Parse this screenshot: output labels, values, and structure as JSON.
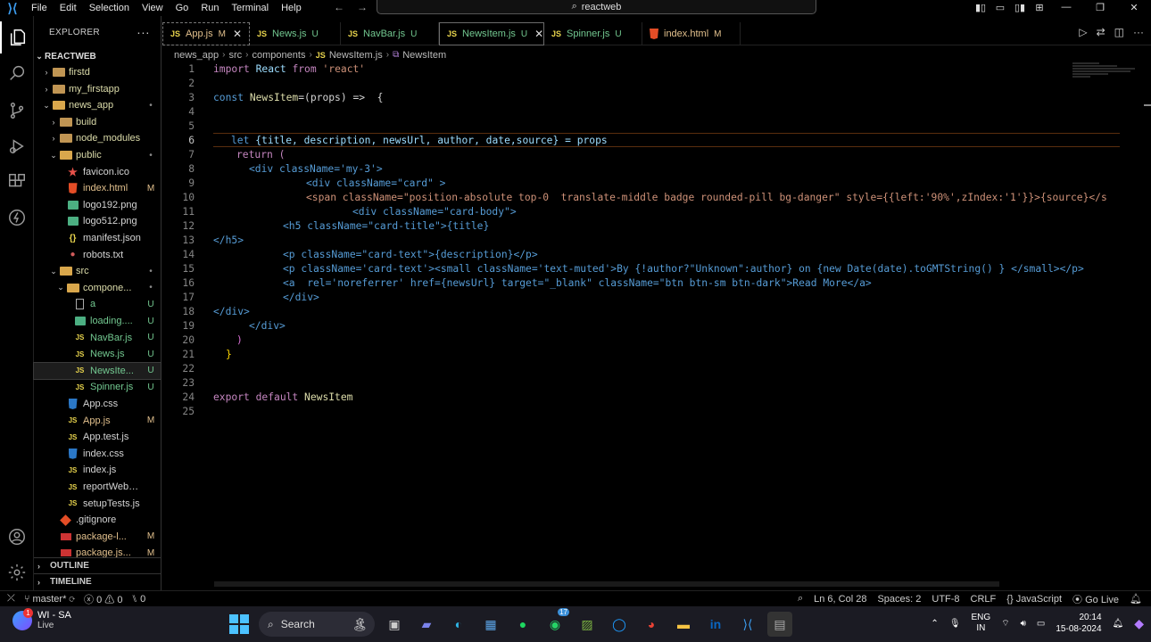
{
  "titlebar": {
    "menu": [
      "File",
      "Edit",
      "Selection",
      "View",
      "Go",
      "Run",
      "Terminal",
      "Help"
    ],
    "search_text": "reactweb"
  },
  "sidebar": {
    "title": "EXPLORER",
    "root": "REACTWEB",
    "items": [
      {
        "label": "firstd",
        "type": "folder",
        "status": ""
      },
      {
        "label": "my_firstapp",
        "type": "folder",
        "status": ""
      },
      {
        "label": "news_app",
        "type": "folder-open",
        "status": "•"
      },
      {
        "label": "build",
        "type": "folder",
        "status": ""
      },
      {
        "label": "node_modules",
        "type": "folder",
        "status": ""
      },
      {
        "label": "public",
        "type": "folder-open",
        "status": "•"
      },
      {
        "label": "favicon.ico",
        "type": "star",
        "status": ""
      },
      {
        "label": "index.html",
        "type": "html",
        "status": "M"
      },
      {
        "label": "logo192.png",
        "type": "img",
        "status": ""
      },
      {
        "label": "logo512.png",
        "type": "img",
        "status": ""
      },
      {
        "label": "manifest.json",
        "type": "json",
        "status": ""
      },
      {
        "label": "robots.txt",
        "type": "txt",
        "status": ""
      },
      {
        "label": "src",
        "type": "folder-open",
        "status": "•"
      },
      {
        "label": "compone...",
        "type": "folder-open",
        "status": "•"
      },
      {
        "label": "a",
        "type": "file",
        "status": "U"
      },
      {
        "label": "loading....",
        "type": "img",
        "status": "U"
      },
      {
        "label": "NavBar.js",
        "type": "js",
        "status": "U"
      },
      {
        "label": "News.js",
        "type": "js",
        "status": "U"
      },
      {
        "label": "NewsIte...",
        "type": "js",
        "status": "U"
      },
      {
        "label": "Spinner.js",
        "type": "js",
        "status": "U"
      },
      {
        "label": "App.css",
        "type": "css",
        "status": ""
      },
      {
        "label": "App.js",
        "type": "js",
        "status": "M"
      },
      {
        "label": "App.test.js",
        "type": "js",
        "status": ""
      },
      {
        "label": "index.css",
        "type": "css",
        "status": ""
      },
      {
        "label": "index.js",
        "type": "js",
        "status": ""
      },
      {
        "label": "reportWebVital...",
        "type": "js",
        "status": ""
      },
      {
        "label": "setupTests.js",
        "type": "js",
        "status": ""
      },
      {
        "label": ".gitignore",
        "type": "git",
        "status": ""
      },
      {
        "label": "package-l...",
        "type": "npm",
        "status": "M"
      },
      {
        "label": "package.js...",
        "type": "npm",
        "status": "M"
      }
    ],
    "outline": "OUTLINE",
    "timeline": "TIMELINE"
  },
  "tabs": [
    {
      "type": "JS",
      "name": "App.js",
      "status": "M",
      "close": "✕"
    },
    {
      "type": "JS",
      "name": "News.js",
      "status": "U"
    },
    {
      "type": "JS",
      "name": "NavBar.js",
      "status": "U"
    },
    {
      "type": "JS",
      "name": "NewsItem.js",
      "status": "U",
      "close": "✕"
    },
    {
      "type": "JS",
      "name": "Spinner.js",
      "status": "U"
    },
    {
      "type": "",
      "name": "index.html",
      "status": "M"
    }
  ],
  "breadcrumb": [
    "news_app",
    "src",
    "components",
    "NewsItem.js",
    "NewsItem"
  ],
  "code_lines": [
    "1",
    "2",
    "3",
    "4",
    "5",
    "6",
    "7",
    "8",
    "9",
    "10",
    "11",
    "12",
    "13",
    "14",
    "15",
    "16",
    "17",
    "18",
    "19",
    "20",
    "21",
    "22",
    "23",
    "24",
    "25"
  ],
  "code": {
    "l1_import": "import",
    "l1_react": "React",
    "l1_from": "from",
    "l1_str": "'react'",
    "l3_const": "const",
    "l3_name": "NewsItem",
    "l3_rest": "=(props) =>  {",
    "l6_let": "let",
    "l6_rest": "{title, description, newsUrl, author, date,source} = props",
    "l7": "return (",
    "l8": "<div className='my-3'>",
    "l9": "<div className=\"card\" >",
    "l10": "<span className=\"position-absolute top-0  translate-middle badge rounded-pill bg-danger\" style={{left:'90%',zIndex:'1'}}>{source}</s",
    "l11": "<div className=\"card-body\">",
    "l12": "<h5 className=\"card-title\">{title}",
    "l13": "</h5>",
    "l14": "<p className=\"card-text\">{description}</p>",
    "l15": "<p className='card-text'><small className='text-muted'>By {!author?\"Unknown\":author} on {new Date(date).toGMTString() } </small></p>",
    "l16": "<a  rel='noreferrer' href={newsUrl} target=\"_blank\" className=\"btn btn-sm btn-dark\">Read More</a>",
    "l17": "</div>",
    "l18": "</div>",
    "l19": "</div>",
    "l20": ")",
    "l21": "}",
    "l24_export": "export",
    "l24_default": "default",
    "l24_name": "NewsItem"
  },
  "statusbar": {
    "branch": "master*",
    "errors": "0",
    "warnings": "0",
    "ports": "0",
    "position": "Ln 6, Col 28",
    "spaces": "Spaces: 2",
    "encoding": "UTF-8",
    "eol": "CRLF",
    "language": "JavaScript",
    "golive": "Go Live"
  },
  "taskbar": {
    "weather_title": "WI - SA",
    "weather_sub": "Live",
    "weather_badge": "1",
    "search": "Search",
    "whatsapp_badge": "17",
    "lang1": "ENG",
    "lang2": "IN",
    "time": "20:14",
    "date": "15-08-2024"
  }
}
